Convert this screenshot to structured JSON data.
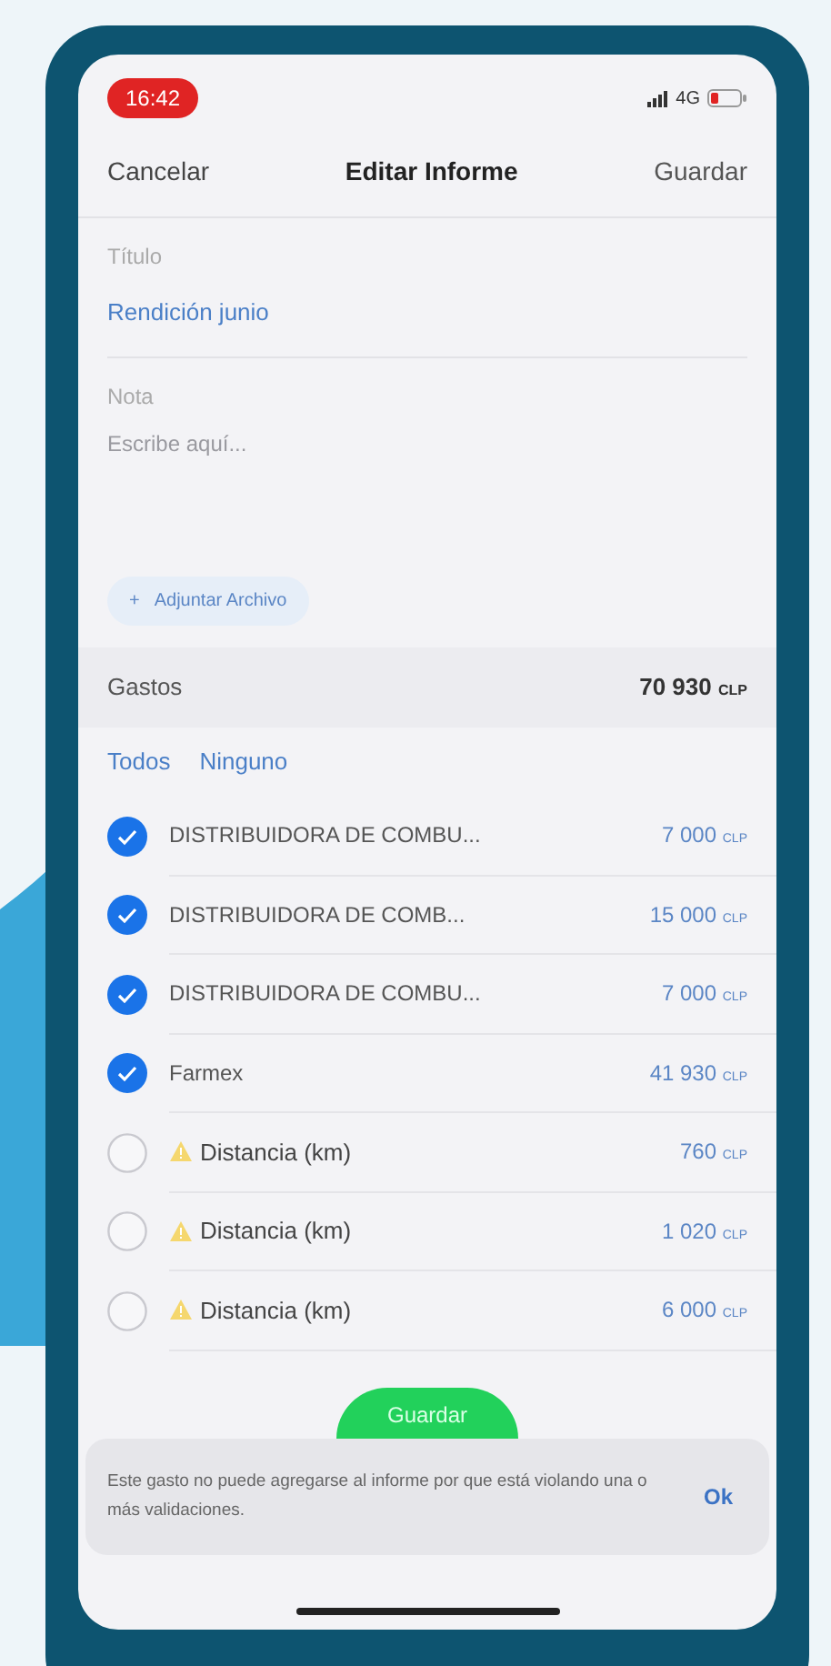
{
  "status_bar": {
    "time": "16:42",
    "network": "4G"
  },
  "nav": {
    "cancel": "Cancelar",
    "title": "Editar Informe",
    "save": "Guardar"
  },
  "title_field": {
    "label": "Título",
    "value": "Rendición junio"
  },
  "note_field": {
    "label": "Nota",
    "placeholder": "Escribe aquí..."
  },
  "attach_button": {
    "icon": "+",
    "label": "Adjuntar Archivo"
  },
  "expenses_header": {
    "label": "Gastos",
    "total": "70 930",
    "currency": "CLP"
  },
  "select_links": [
    "Todos",
    "Ninguno"
  ],
  "expenses": [
    {
      "name": "DISTRIBUIDORA DE COMBU...",
      "amount": "7 000",
      "currency": "CLP",
      "checked": true,
      "warning": false
    },
    {
      "name": "DISTRIBUIDORA DE COMB...",
      "amount": "15 000",
      "currency": "CLP",
      "checked": true,
      "warning": false
    },
    {
      "name": "DISTRIBUIDORA DE COMBU...",
      "amount": "7 000",
      "currency": "CLP",
      "checked": true,
      "warning": false
    },
    {
      "name": "Farmex",
      "amount": "41 930",
      "currency": "CLP",
      "checked": true,
      "warning": false
    },
    {
      "name": "Distancia (km)",
      "amount": "760",
      "currency": "CLP",
      "checked": false,
      "warning": true
    },
    {
      "name": "Distancia (km)",
      "amount": "1 020",
      "currency": "CLP",
      "checked": false,
      "warning": true
    },
    {
      "name": "Distancia (km)",
      "amount": "6 000",
      "currency": "CLP",
      "checked": false,
      "warning": true
    }
  ],
  "save_button": "Guardar",
  "snackbar": {
    "message": "Este gasto no puede agregarse al informe por que está violando una o más validaciones.",
    "action": "Ok"
  }
}
